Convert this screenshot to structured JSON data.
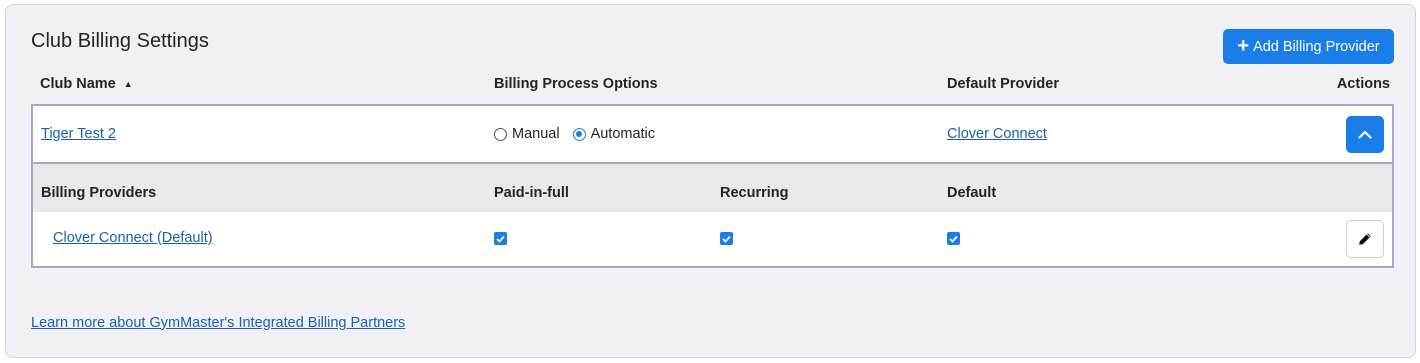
{
  "title": "Club Billing Settings",
  "add_button": {
    "icon": "plus-icon",
    "label": "Add Billing Provider"
  },
  "columns": {
    "club_name": "Club Name",
    "billing_process": "Billing Process Options",
    "default_provider": "Default Provider",
    "actions": "Actions"
  },
  "club": {
    "name": "Tiger Test 2",
    "options": [
      {
        "label": "Manual",
        "selected": false
      },
      {
        "label": "Automatic",
        "selected": true
      }
    ],
    "default_provider": "Clover Connect",
    "action_icon": "chevron-up-icon"
  },
  "providers_table": {
    "headers": {
      "billing_providers": "Billing Providers",
      "paid_in_full": "Paid-in-full",
      "recurring": "Recurring",
      "default": "Default"
    },
    "rows": [
      {
        "name": "Clover Connect (Default)",
        "paid_in_full": true,
        "recurring": true,
        "default": true,
        "action_icon": "pencil-icon"
      }
    ]
  },
  "learn_more_link": "Learn more about GymMaster's Integrated Billing Partners",
  "colors": {
    "primary": "#1a7de8",
    "link": "#1c5fb0",
    "panel_bg": "#f1f1f5",
    "border": "#a9a6c2"
  }
}
